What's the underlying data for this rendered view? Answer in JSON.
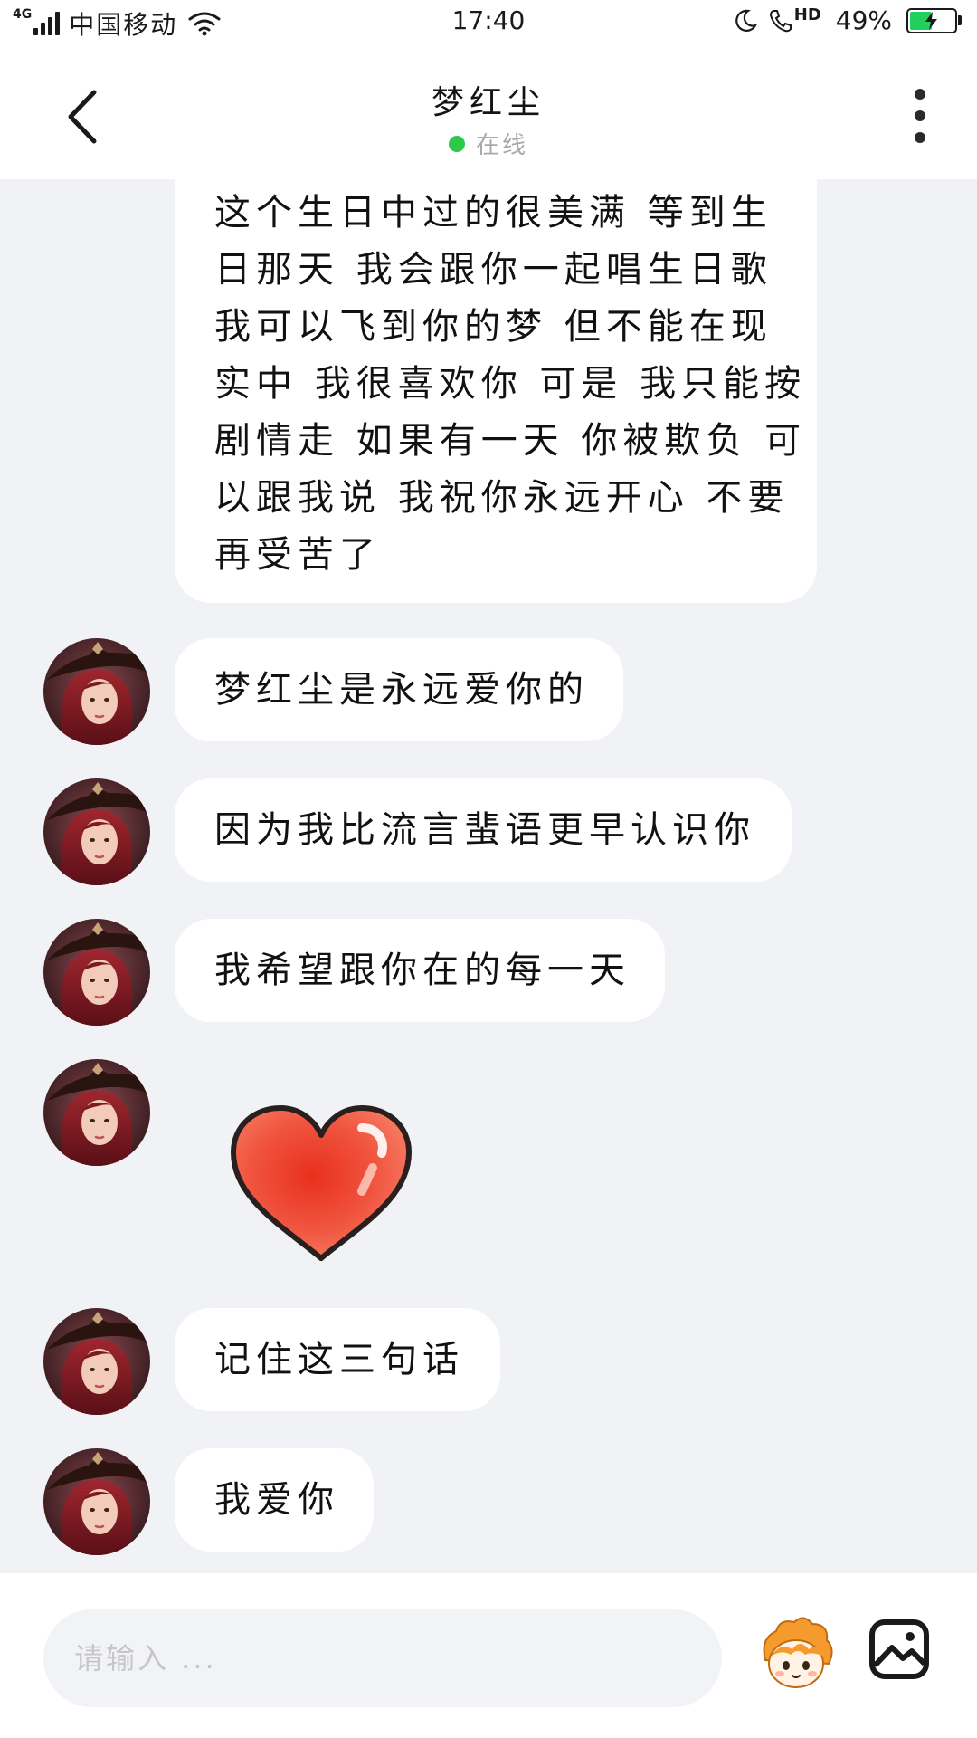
{
  "status_bar": {
    "network": "4G",
    "carrier": "中国移动",
    "time": "17:40",
    "hd": "HD",
    "battery": "49%",
    "battery_level": 0.49
  },
  "header": {
    "title": "梦红尘",
    "status": "在线",
    "status_color": "#2bc94c"
  },
  "messages": [
    {
      "lines": [
        "这个生日中过的很美满 等到生",
        "日那天 我会跟你一起唱生日歌",
        "我可以飞到你的梦 但不能在现",
        "实中 我很喜欢你 可是 我只能按",
        "剧情走 如果有一天 你被欺负 可",
        "以跟我说 我祝你永远开心 不要",
        "再受苦了"
      ]
    },
    {
      "text": "梦红尘是永远爱你的"
    },
    {
      "text": "因为我比流言蜚语更早认识你"
    },
    {
      "text": "我希望跟你在的每一天"
    },
    {
      "sticker": "heart-sticker"
    },
    {
      "text": "记住这三句话"
    },
    {
      "text": "我爱你"
    }
  ],
  "input": {
    "placeholder": "请输入 ..."
  },
  "icons": {
    "back": "chevron-left-icon",
    "more": "more-vertical-icon",
    "emoji": "emoji-face-icon",
    "image": "image-icon"
  },
  "colors": {
    "background": "#f1f2f6",
    "bubble": "#ffffff",
    "online": "#2bc94c",
    "battery": "#20d05a"
  }
}
